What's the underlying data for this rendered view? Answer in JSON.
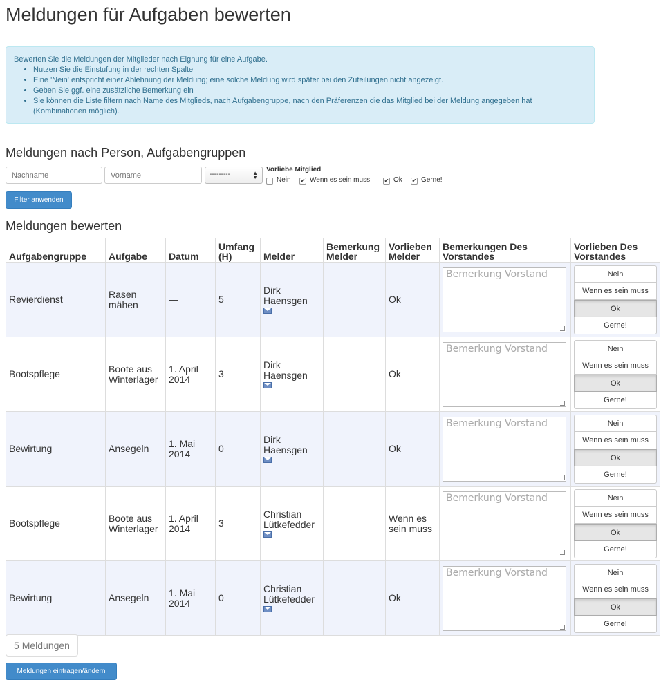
{
  "page": {
    "title": "Meldungen für Aufgaben bewerten"
  },
  "info": {
    "intro": "Bewerten Sie die Meldungen der Mitglieder nach Eignung für eine Aufgabe.",
    "bullets": [
      "Nutzen Sie die Einstufung in der rechten Spalte",
      "Eine 'Nein' entspricht einer Ablehnung der Meldung; eine solche Meldung wird später bei den Zuteilungen nicht angezeigt.",
      "Geben Sie ggf. eine zusätzliche Bemerkung ein",
      "Sie können die Liste filtern nach Name des Mitglieds, nach Aufgabengruppe, nach den Präferenzen die das Mitglied bei der Meldung angegeben hat",
      "(Kombinationen möglich)."
    ]
  },
  "filter": {
    "heading": "Meldungen nach Person, Aufgabengruppen",
    "lastname_placeholder": "Nachname",
    "firstname_placeholder": "Vorname",
    "group_select_value": "---------",
    "pref_label": "Vorliebe Mitglied",
    "options": [
      {
        "label": "Nein",
        "checked": false
      },
      {
        "label": "Wenn es sein muss",
        "checked": true
      },
      {
        "label": "Ok",
        "checked": true
      },
      {
        "label": "Gerne!",
        "checked": true
      }
    ],
    "apply_label": "Filter anwenden"
  },
  "rating": {
    "heading": "Meldungen bewerten",
    "columns": [
      [
        "Aufgabengruppe"
      ],
      [
        "Aufgabe"
      ],
      [
        "Datum"
      ],
      [
        "Umfang",
        "(H)"
      ],
      [
        "Melder"
      ],
      [
        "Bemerkung",
        "Melder"
      ],
      [
        "Vorlieben",
        "Melder"
      ],
      [
        "Bemerkungen Des",
        "Vorstandes"
      ],
      [
        "Vorlieben Des",
        "Vorstandes"
      ]
    ],
    "remark_placeholder": "Bemerkung Vorstand",
    "rate_options": [
      "Nein",
      "Wenn es sein muss",
      "Ok",
      "Gerne!"
    ],
    "rows": [
      {
        "group": "Revierdienst",
        "task": [
          "Rasen",
          "mähen"
        ],
        "date": [
          "—"
        ],
        "hours": "5",
        "person": [
          "Dirk",
          "Haensgen"
        ],
        "remark": "",
        "pref": [
          "Ok"
        ],
        "selected": "Ok"
      },
      {
        "group": "Bootspflege",
        "task": [
          "Boote aus",
          "Winterlager"
        ],
        "date": [
          "1. April",
          "2014"
        ],
        "hours": "3",
        "person": [
          "Dirk",
          "Haensgen"
        ],
        "remark": "",
        "pref": [
          "Ok"
        ],
        "selected": "Ok"
      },
      {
        "group": "Bewirtung",
        "task": [
          "Ansegeln"
        ],
        "date": [
          "1. Mai",
          "2014"
        ],
        "hours": "0",
        "person": [
          "Dirk",
          "Haensgen"
        ],
        "remark": "",
        "pref": [
          "Ok"
        ],
        "selected": "Ok"
      },
      {
        "group": "Bootspflege",
        "task": [
          "Boote aus",
          "Winterlager"
        ],
        "date": [
          "1. April",
          "2014"
        ],
        "hours": "3",
        "person": [
          "Christian",
          "Lütkefedder"
        ],
        "remark": "",
        "pref": [
          "Wenn es",
          "sein muss"
        ],
        "selected": "Ok"
      },
      {
        "group": "Bewirtung",
        "task": [
          "Ansegeln"
        ],
        "date": [
          "1. Mai",
          "2014"
        ],
        "hours": "0",
        "person": [
          "Christian",
          "Lütkefedder"
        ],
        "remark": "",
        "pref": [
          "Ok"
        ],
        "selected": "Ok"
      }
    ],
    "count_label": "5 Meldungen",
    "submit_label": "Meldungen eintragen/ändern"
  },
  "colors": {
    "primary": "#428bca",
    "info_bg": "#d9edf7",
    "info_text": "#31708f",
    "row_alt": "#f0f3fc"
  }
}
